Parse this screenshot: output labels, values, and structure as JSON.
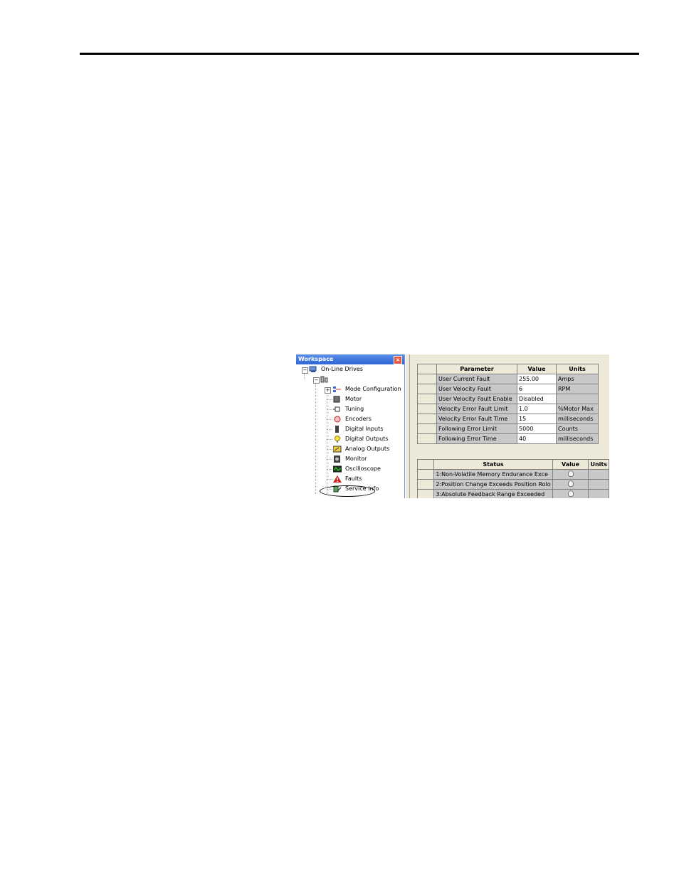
{
  "workspace": {
    "title": "Workspace",
    "tree": {
      "root": "On-Line Drives",
      "items": [
        {
          "label": "Mode Configuration",
          "icon": "mode-configuration-icon"
        },
        {
          "label": "Motor",
          "icon": "motor-icon"
        },
        {
          "label": "Tuning",
          "icon": "tuning-icon"
        },
        {
          "label": "Encoders",
          "icon": "encoders-icon"
        },
        {
          "label": "Digital Inputs",
          "icon": "digital-inputs-icon"
        },
        {
          "label": "Digital Outputs",
          "icon": "digital-outputs-icon"
        },
        {
          "label": "Analog Outputs",
          "icon": "analog-outputs-icon"
        },
        {
          "label": "Monitor",
          "icon": "monitor-icon"
        },
        {
          "label": "Oscilloscope",
          "icon": "oscilloscope-icon"
        },
        {
          "label": "Faults",
          "icon": "faults-warning-icon"
        },
        {
          "label": "Service Info",
          "icon": "service-info-icon"
        }
      ]
    }
  },
  "parameters": {
    "headers": [
      "Parameter",
      "Value",
      "Units"
    ],
    "rows": [
      {
        "parameter": "User Current Fault",
        "value": "255.00",
        "units": "Amps"
      },
      {
        "parameter": "User Velocity Fault",
        "value": "6",
        "units": "RPM"
      },
      {
        "parameter": "User Velocity Fault Enable",
        "value": "Disabled",
        "units": ""
      },
      {
        "parameter": "Velocity Error Fault Limit",
        "value": "1.0",
        "units": "%Motor Max"
      },
      {
        "parameter": "Velocity Error Fault Time",
        "value": "15",
        "units": "milliseconds"
      },
      {
        "parameter": "Following Error Limit",
        "value": "5000",
        "units": "Counts"
      },
      {
        "parameter": "Following Error Time",
        "value": "40",
        "units": "milliseconds"
      }
    ]
  },
  "status": {
    "headers": [
      "Status",
      "Value",
      "Units"
    ],
    "rows": [
      {
        "status": "1:Non-Volatile Memory Endurance Exce"
      },
      {
        "status": "2:Position Change Exceeds Position Rolo"
      },
      {
        "status": "3:Absolute Feedback Range Exceeded"
      }
    ]
  }
}
